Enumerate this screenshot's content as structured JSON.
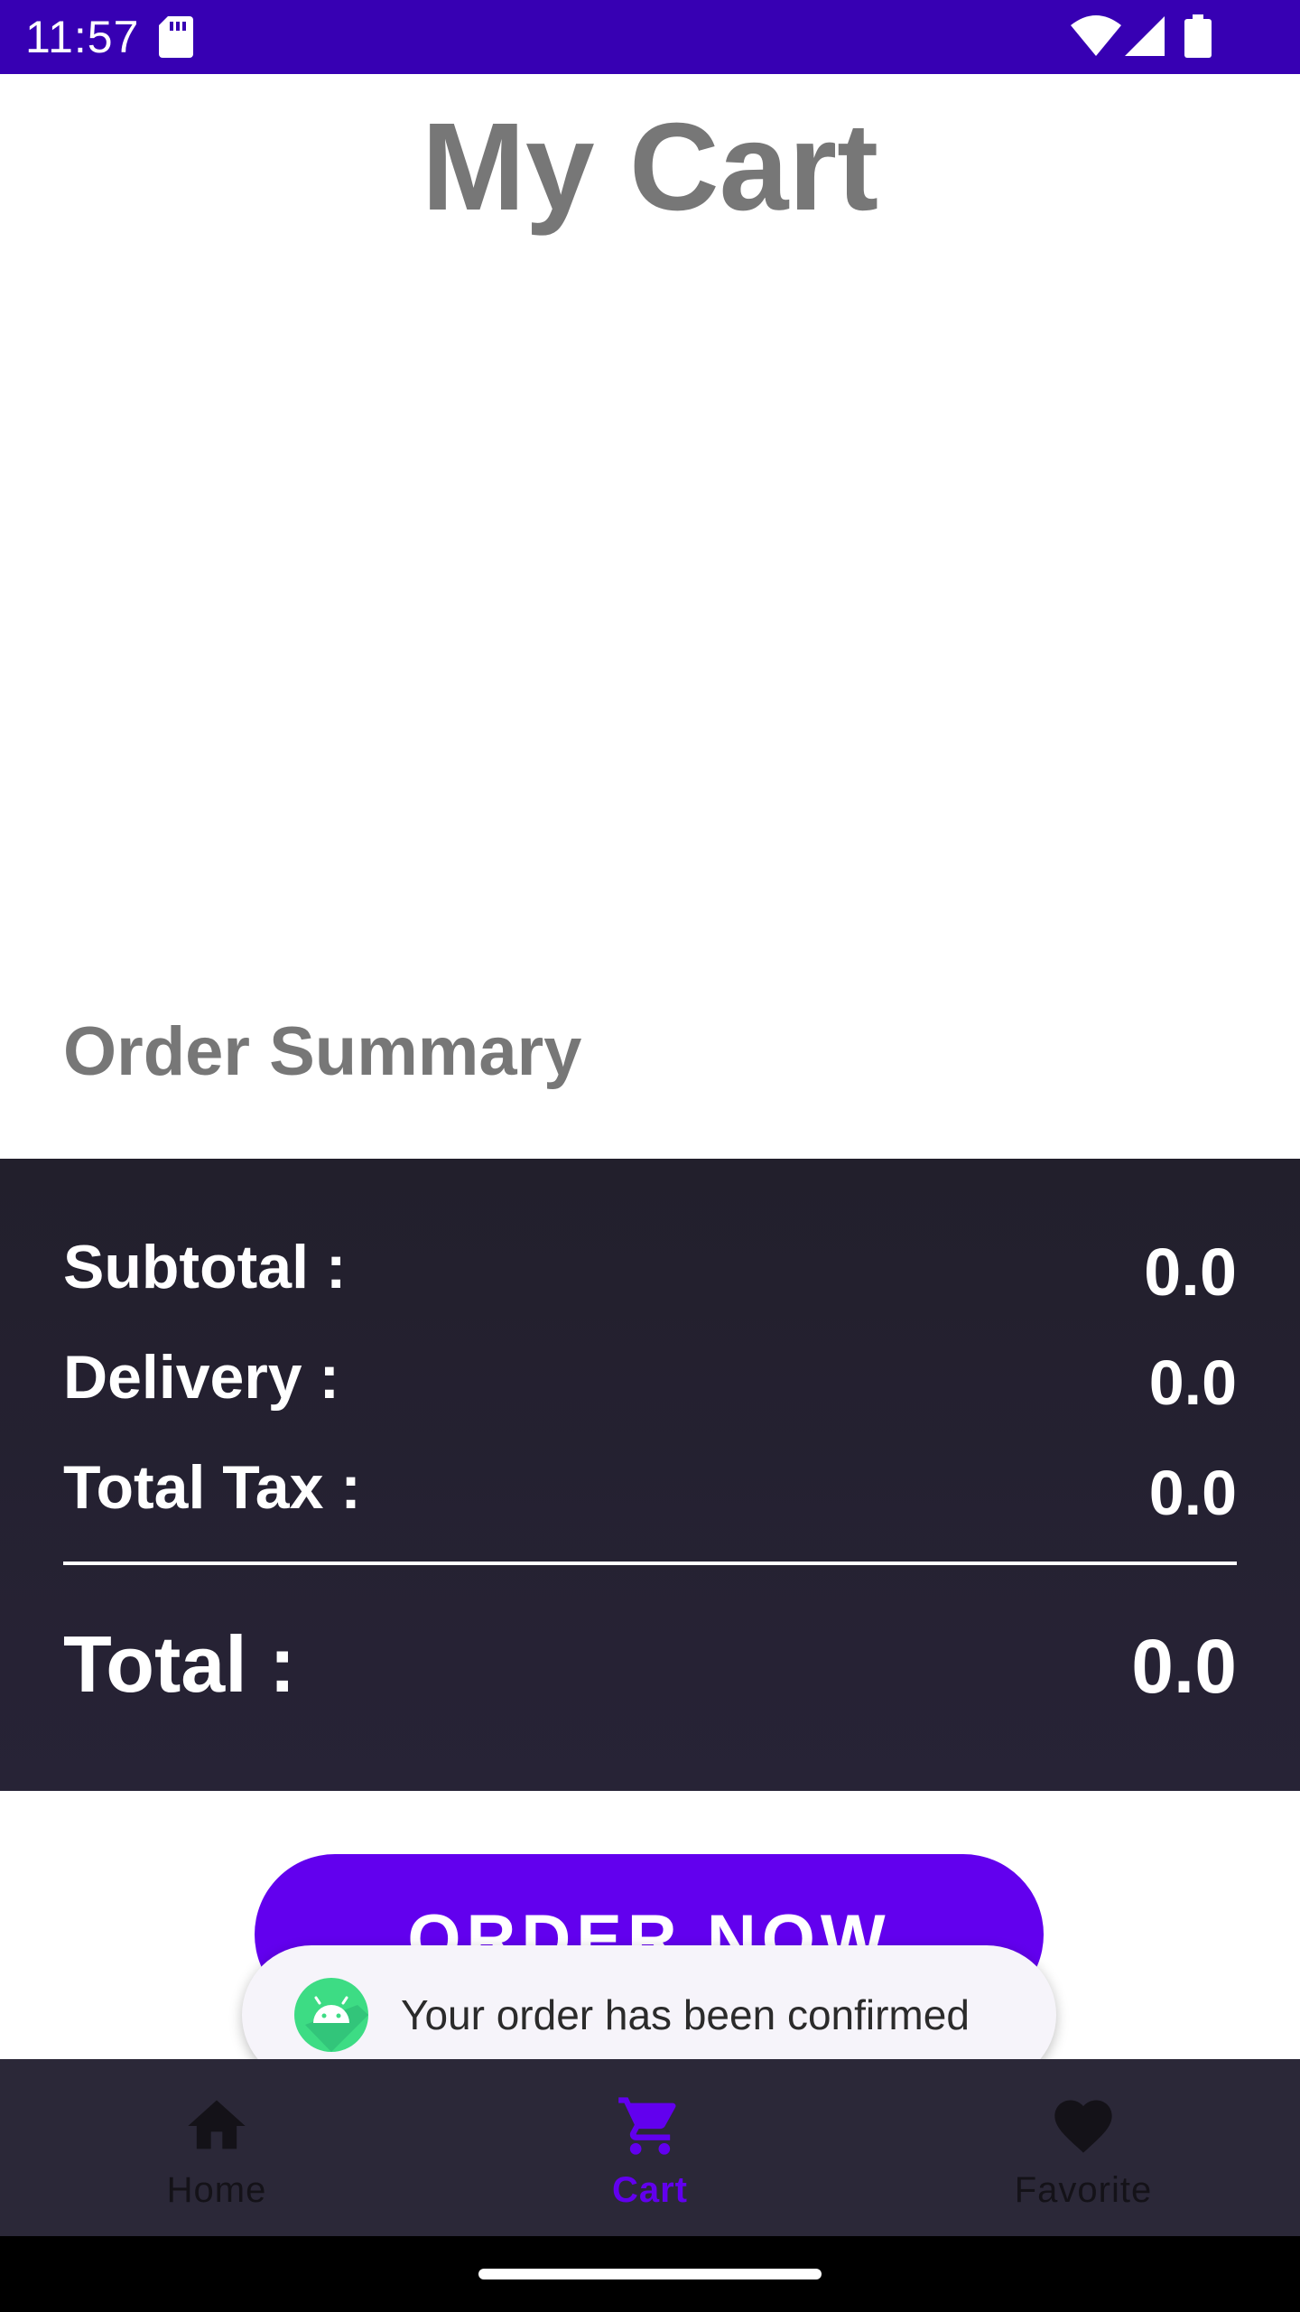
{
  "status_bar": {
    "time": "11:57",
    "icons": [
      "sd-card-icon",
      "wifi-icon",
      "cell-signal-icon",
      "battery-icon"
    ],
    "background": "#3700b3"
  },
  "page": {
    "title": "My Cart"
  },
  "order_summary": {
    "heading": "Order Summary",
    "rows": [
      {
        "label": "Subtotal :",
        "value": "0.0"
      },
      {
        "label": "Delivery :",
        "value": "0.0"
      },
      {
        "label": "Total Tax :",
        "value": "0.0"
      }
    ],
    "total": {
      "label": "Total :",
      "value": "0.0"
    }
  },
  "order_button": {
    "label": "ORDER NOW",
    "color": "#6200ee"
  },
  "toast": {
    "text": "Your order has been confirmed",
    "icon": "android-app-icon"
  },
  "bottom_nav": {
    "items": [
      {
        "label": "Home",
        "icon": "home-icon",
        "active": false
      },
      {
        "label": "Cart",
        "icon": "cart-icon",
        "active": true
      },
      {
        "label": "Favorite",
        "icon": "heart-icon",
        "active": false
      }
    ],
    "active_color": "#6200ee"
  }
}
